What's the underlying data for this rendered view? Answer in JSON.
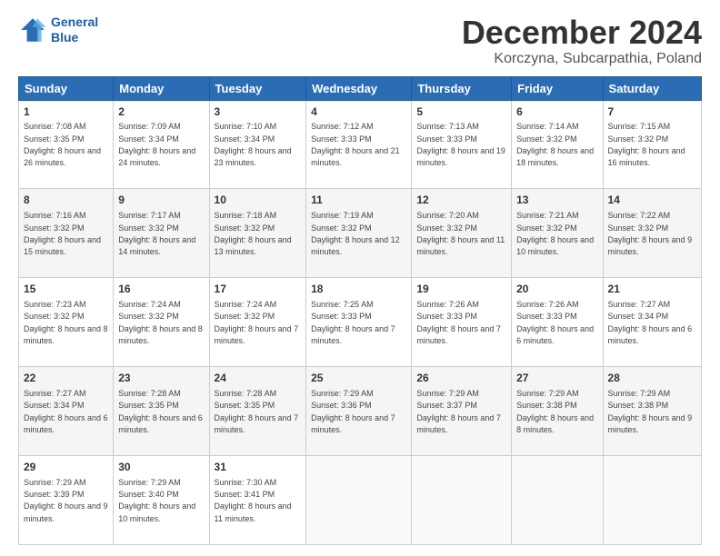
{
  "logo": {
    "line1": "General",
    "line2": "Blue"
  },
  "title": "December 2024",
  "subtitle": "Korczyna, Subcarpathia, Poland",
  "days_of_week": [
    "Sunday",
    "Monday",
    "Tuesday",
    "Wednesday",
    "Thursday",
    "Friday",
    "Saturday"
  ],
  "weeks": [
    [
      {
        "day": 1,
        "sunrise": "7:08 AM",
        "sunset": "3:35 PM",
        "daylight": "8 hours and 26 minutes."
      },
      {
        "day": 2,
        "sunrise": "7:09 AM",
        "sunset": "3:34 PM",
        "daylight": "8 hours and 24 minutes."
      },
      {
        "day": 3,
        "sunrise": "7:10 AM",
        "sunset": "3:34 PM",
        "daylight": "8 hours and 23 minutes."
      },
      {
        "day": 4,
        "sunrise": "7:12 AM",
        "sunset": "3:33 PM",
        "daylight": "8 hours and 21 minutes."
      },
      {
        "day": 5,
        "sunrise": "7:13 AM",
        "sunset": "3:33 PM",
        "daylight": "8 hours and 19 minutes."
      },
      {
        "day": 6,
        "sunrise": "7:14 AM",
        "sunset": "3:32 PM",
        "daylight": "8 hours and 18 minutes."
      },
      {
        "day": 7,
        "sunrise": "7:15 AM",
        "sunset": "3:32 PM",
        "daylight": "8 hours and 16 minutes."
      }
    ],
    [
      {
        "day": 8,
        "sunrise": "7:16 AM",
        "sunset": "3:32 PM",
        "daylight": "8 hours and 15 minutes."
      },
      {
        "day": 9,
        "sunrise": "7:17 AM",
        "sunset": "3:32 PM",
        "daylight": "8 hours and 14 minutes."
      },
      {
        "day": 10,
        "sunrise": "7:18 AM",
        "sunset": "3:32 PM",
        "daylight": "8 hours and 13 minutes."
      },
      {
        "day": 11,
        "sunrise": "7:19 AM",
        "sunset": "3:32 PM",
        "daylight": "8 hours and 12 minutes."
      },
      {
        "day": 12,
        "sunrise": "7:20 AM",
        "sunset": "3:32 PM",
        "daylight": "8 hours and 11 minutes."
      },
      {
        "day": 13,
        "sunrise": "7:21 AM",
        "sunset": "3:32 PM",
        "daylight": "8 hours and 10 minutes."
      },
      {
        "day": 14,
        "sunrise": "7:22 AM",
        "sunset": "3:32 PM",
        "daylight": "8 hours and 9 minutes."
      }
    ],
    [
      {
        "day": 15,
        "sunrise": "7:23 AM",
        "sunset": "3:32 PM",
        "daylight": "8 hours and 8 minutes."
      },
      {
        "day": 16,
        "sunrise": "7:24 AM",
        "sunset": "3:32 PM",
        "daylight": "8 hours and 8 minutes."
      },
      {
        "day": 17,
        "sunrise": "7:24 AM",
        "sunset": "3:32 PM",
        "daylight": "8 hours and 7 minutes."
      },
      {
        "day": 18,
        "sunrise": "7:25 AM",
        "sunset": "3:33 PM",
        "daylight": "8 hours and 7 minutes."
      },
      {
        "day": 19,
        "sunrise": "7:26 AM",
        "sunset": "3:33 PM",
        "daylight": "8 hours and 7 minutes."
      },
      {
        "day": 20,
        "sunrise": "7:26 AM",
        "sunset": "3:33 PM",
        "daylight": "8 hours and 6 minutes."
      },
      {
        "day": 21,
        "sunrise": "7:27 AM",
        "sunset": "3:34 PM",
        "daylight": "8 hours and 6 minutes."
      }
    ],
    [
      {
        "day": 22,
        "sunrise": "7:27 AM",
        "sunset": "3:34 PM",
        "daylight": "8 hours and 6 minutes."
      },
      {
        "day": 23,
        "sunrise": "7:28 AM",
        "sunset": "3:35 PM",
        "daylight": "8 hours and 6 minutes."
      },
      {
        "day": 24,
        "sunrise": "7:28 AM",
        "sunset": "3:35 PM",
        "daylight": "8 hours and 7 minutes."
      },
      {
        "day": 25,
        "sunrise": "7:29 AM",
        "sunset": "3:36 PM",
        "daylight": "8 hours and 7 minutes."
      },
      {
        "day": 26,
        "sunrise": "7:29 AM",
        "sunset": "3:37 PM",
        "daylight": "8 hours and 7 minutes."
      },
      {
        "day": 27,
        "sunrise": "7:29 AM",
        "sunset": "3:38 PM",
        "daylight": "8 hours and 8 minutes."
      },
      {
        "day": 28,
        "sunrise": "7:29 AM",
        "sunset": "3:38 PM",
        "daylight": "8 hours and 9 minutes."
      }
    ],
    [
      {
        "day": 29,
        "sunrise": "7:29 AM",
        "sunset": "3:39 PM",
        "daylight": "8 hours and 9 minutes."
      },
      {
        "day": 30,
        "sunrise": "7:29 AM",
        "sunset": "3:40 PM",
        "daylight": "8 hours and 10 minutes."
      },
      {
        "day": 31,
        "sunrise": "7:30 AM",
        "sunset": "3:41 PM",
        "daylight": "8 hours and 11 minutes."
      },
      null,
      null,
      null,
      null
    ]
  ]
}
